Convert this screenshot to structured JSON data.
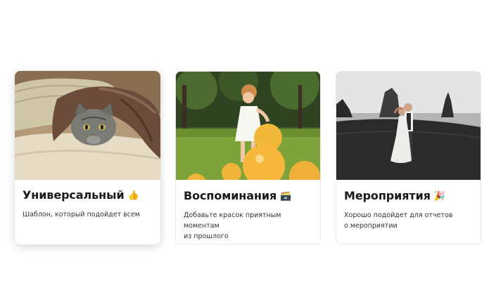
{
  "templates": [
    {
      "title": "Универсальный",
      "emoji": "👍",
      "description_lines": [
        "Шаблон, который подойдет всем"
      ],
      "photo_subject": "cat-under-blanket"
    },
    {
      "title": "Воспоминания",
      "emoji": "🗃️",
      "description_lines": [
        "Добавьте красок приятным моментам",
        "из прошлого"
      ],
      "photo_subject": "girl-with-balloons"
    },
    {
      "title": "Мероприятия",
      "emoji": "🎉",
      "description_lines": [
        "Хорошо подойдет для отчетов",
        "о мероприятии"
      ],
      "photo_subject": "wedding-couple-on-beach"
    }
  ]
}
